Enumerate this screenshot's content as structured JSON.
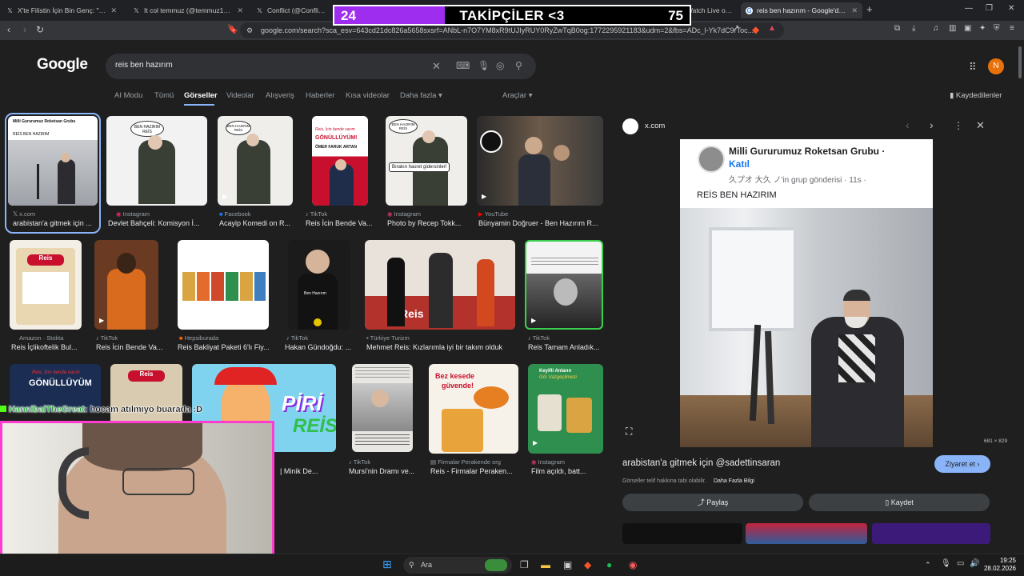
{
  "tabs": [
    {
      "title": "X'te Filistin İçin Bin Genç: \"UDRUB U...",
      "icon": "X"
    },
    {
      "title": "It col temmuz (@temmuz1919) / X",
      "icon": "X"
    },
    {
      "title": "Conflict (@ConflictTR) / X",
      "icon": "X"
    },
    {
      "title": "Nuyan Stream - Watch Live on Kick",
      "icon": "K"
    },
    {
      "title": "reis ben hazırım - Google'da Ara",
      "icon": "G"
    }
  ],
  "overlay": {
    "left": "24",
    "center": "TAKİPÇİLER <3",
    "right": "75",
    "progress": 0.31
  },
  "address": {
    "url": "google.com/search?sca_esv=643cd21dc826a5658sxsrf=ANbL-n7O7YM8xR9tUJIyRUY0RyZwTqB0og:1772295921183&udm=2&fbs=ADc_l-Yk7dC9rToc..."
  },
  "google": {
    "logo": "Google",
    "query": "reis ben hazırım",
    "saved_label": "Kaydedilenler",
    "avatar": "N",
    "tools": "Araçlar",
    "nav": [
      "AI Modu",
      "Tümü",
      "Görseller",
      "Videolar",
      "Alışveriş",
      "Haberler",
      "Kısa videolar",
      "Daha fazla"
    ]
  },
  "results": [
    {
      "source": "x.com",
      "title": "arabistan'a gitmek için ..."
    },
    {
      "source": "Instagram",
      "title": "Devlet Bahçeli: Komisyon İ..."
    },
    {
      "source": "Facebook",
      "title": "Acayip Komedi on R..."
    },
    {
      "source": "TikTok",
      "title": "Reis İcin Bende Va..."
    },
    {
      "source": "Instagram",
      "title": "Photo by Recep Tokk..."
    },
    {
      "source": "YouTube",
      "title": "Bünyamin Doğruer - Ben Hazırım R..."
    },
    {
      "source": "Amazon · Stokta",
      "title": "Reis İçlikoftelik Bul..."
    },
    {
      "source": "TikTok",
      "title": "Reis İcin Bende Va..."
    },
    {
      "source": "Hepsiburada",
      "title": "Reis Bakliyat Paketi 6'lı Fiy..."
    },
    {
      "source": "TikTok",
      "title": "Hakan Gündoğdu: ..."
    },
    {
      "source": "Türkiye Turizm",
      "title": "Mehmet Reis: Kızlarımla iyi bir takım olduk"
    },
    {
      "source": "TikTok",
      "title": "Reis Tamam Anladık..."
    },
    {
      "source": "",
      "title": "| Minik De..."
    },
    {
      "source": "TikTok",
      "title": "Mursi'nin Dramı ve..."
    },
    {
      "source": "Firmalar Perakende org",
      "title": "Reis - Firmalar Peraken..."
    },
    {
      "source": "Instagram",
      "title": "Film açıldı, batt..."
    }
  ],
  "image_text": {
    "r1_2": "BEN HAZIRIM REİS",
    "r1_3": "BEN HAZIRIM REİS",
    "r1_4a": "Reis, İcin bende varım",
    "r1_4b": "GÖNÜLLÜYÜM!",
    "r1_4c": "ÖMER FARUK ARTAN",
    "r1_5a": "BEN HAZIRIM REİS",
    "r1_5b": "Bırakın hasret gidersinler!",
    "r2_1": "Reis",
    "r2_4": "Ben Hazırım",
    "r2_5": "Reis",
    "r3_1a": "Reis, İcin bende varım",
    "r3_1b": "GÖNÜLLÜYÜM",
    "r3_2": "Reis",
    "r3_3a": "PİRİ",
    "r3_3b": "REİS",
    "r3_5a": "Bez kesede",
    "r3_5b": "güvende!",
    "r3_6a": "Keyifli Anların",
    "r3_6b": "Gör Vazgeçilmezi",
    "r1_1a": "Milli Gururumuz Roketsan Grubu",
    "r1_1b": "REİS BEN HAZIRIM"
  },
  "panel": {
    "site": "x.com",
    "post_title": "Milli Gururumuz Roketsan Grubu ·",
    "post_join": "Katıl",
    "post_meta": "久プオ 大久 ノ'in grup gönderisi · 11s ·",
    "post_text": "REİS BEN HAZIRIM",
    "dimensions": "681 × 829",
    "title": "arabistan'a gitmek için @sadettinsaran",
    "visit": "Ziyaret et",
    "copyright": "Görseller telif hakkına tabi olabilir.",
    "more_info": "Daha Fazla Bilgi",
    "share": "Paylaş",
    "save": "Kaydet"
  },
  "chat": {
    "user": "HannibalTheGreat",
    "message": ": hocam atılmıyo buarada :D"
  },
  "taskbar": {
    "search": "Ara",
    "time": "19:25",
    "date": "28.02.2026"
  },
  "colors": {
    "accent": "#8ab4f8",
    "overlay_fill": "#9f2df0",
    "webcam_border": "#ff3ccf"
  }
}
